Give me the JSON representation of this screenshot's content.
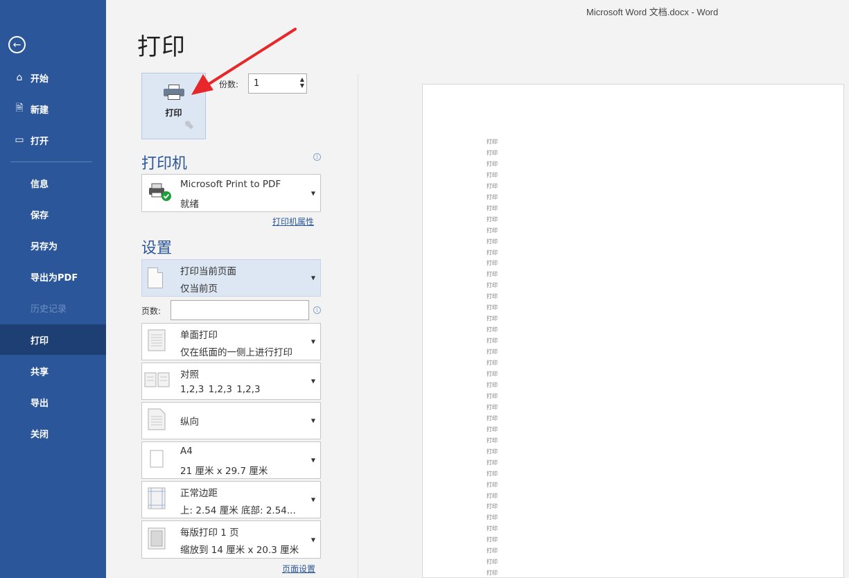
{
  "window": {
    "title": "Microsoft Word 文档.docx  -  Word"
  },
  "sidebar": {
    "back_icon": "back-arrow-icon",
    "items": [
      {
        "label": "开始",
        "icon": "home-icon"
      },
      {
        "label": "新建",
        "icon": "new-document-icon"
      },
      {
        "label": "打开",
        "icon": "folder-open-icon"
      },
      {
        "label": "信息"
      },
      {
        "label": "保存"
      },
      {
        "label": "另存为"
      },
      {
        "label": "导出为PDF"
      },
      {
        "label": "历史记录",
        "disabled": true
      },
      {
        "label": "打印",
        "active": true
      },
      {
        "label": "共享"
      },
      {
        "label": "导出"
      },
      {
        "label": "关闭"
      }
    ]
  },
  "print": {
    "heading": "打印",
    "button_label": "打印",
    "copies_label": "份数:",
    "copies_value": "1"
  },
  "printer": {
    "section_title": "打印机",
    "name": "Microsoft Print to PDF",
    "status": "就绪",
    "properties_link": "打印机属性"
  },
  "settings": {
    "section_title": "设置",
    "range": {
      "line1": "打印当前页面",
      "line2": "仅当前页"
    },
    "pages_label": "页数:",
    "pages_value": "",
    "sides": {
      "line1": "单面打印",
      "line2": "仅在纸面的一侧上进行打印"
    },
    "collate": {
      "line1": "对照",
      "line2": "1,2,3    1,2,3    1,2,3"
    },
    "orientation": {
      "line1": "纵向"
    },
    "paper": {
      "line1": "A4",
      "line2": "21 厘米 x 29.7 厘米"
    },
    "margins": {
      "line1": "正常边距",
      "line2": "上: 2.54 厘米 底部: 2.54..."
    },
    "per_sheet": {
      "line1": "每版打印 1 页",
      "line2": "缩放到 14 厘米 x 20.3 厘米"
    },
    "page_setup_link": "页面设置"
  },
  "preview": {
    "line_text": "打印",
    "line_count": 41
  },
  "colors": {
    "sidebar": "#2b579a",
    "sidebar_active": "#1e3f73",
    "accent": "#2b579a",
    "annotation_arrow": "#e8272a"
  }
}
